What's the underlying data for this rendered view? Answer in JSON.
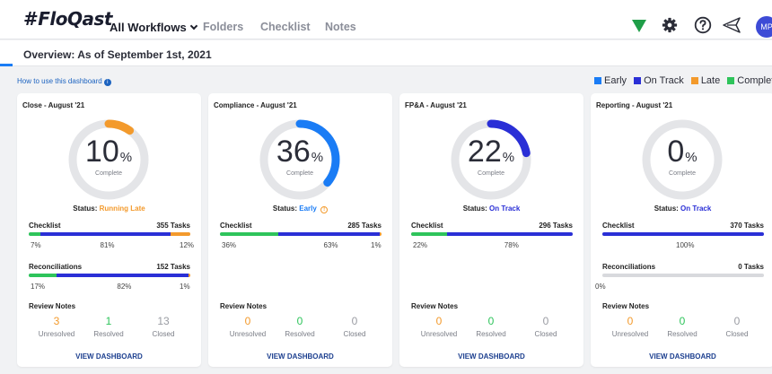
{
  "app": {
    "logo_text": "FloQast",
    "logo_hash": "#",
    "nav_main": "All Workflows",
    "nav": [
      "Folders",
      "Checklist",
      "Notes"
    ],
    "avatar": "MP",
    "icons": [
      "flag-icon",
      "gear-icon",
      "help-icon",
      "send-icon"
    ]
  },
  "overview": "Overview: As of September 1st, 2021",
  "howto": "How to use this dashboard",
  "legend": [
    {
      "label": "Early",
      "color": "#1a7cf5"
    },
    {
      "label": "On Track",
      "color": "#2a2fd6"
    },
    {
      "label": "Late",
      "color": "#f39a2c"
    },
    {
      "label": "Complete",
      "color": "#2ec45b"
    }
  ],
  "colors": {
    "early": "#1a7cf5",
    "on_track": "#2a2fd6",
    "late": "#f39a2c",
    "complete": "#2ec45b",
    "ring": "#e4e5e8",
    "link": "#1c3f8f"
  },
  "cards": [
    {
      "title": "Close - August '21",
      "percent": "10",
      "percent_value": 10,
      "ring_color": "#f39a2c",
      "complete_label": "Complete",
      "status_label": "Status:",
      "status_value": "Running Late",
      "status_color": "#f39a2c",
      "status_warn": "",
      "checklist": {
        "label": "Checklist",
        "tasks": "355 Tasks",
        "segments": [
          {
            "pct": 7,
            "color": "#2ec45b",
            "label": "7%"
          },
          {
            "pct": 81,
            "color": "#2a2fd6",
            "label": "81%"
          },
          {
            "pct": 12,
            "color": "#f39a2c",
            "label": "12%"
          }
        ]
      },
      "reconciliations": {
        "label": "Reconciliations",
        "tasks": "152 Tasks",
        "segments": [
          {
            "pct": 17,
            "color": "#2ec45b",
            "label": "17%"
          },
          {
            "pct": 82,
            "color": "#2a2fd6",
            "label": "82%"
          },
          {
            "pct": 1,
            "color": "#f39a2c",
            "label": "1%"
          }
        ]
      },
      "review_notes": {
        "label": "Review Notes",
        "items": [
          {
            "value": "3",
            "label": "Unresolved",
            "color": "#f39a2c"
          },
          {
            "value": "1",
            "label": "Resolved",
            "color": "#2ec45b"
          },
          {
            "value": "13",
            "label": "Closed",
            "color": "#9a9ca3"
          }
        ]
      },
      "view": "VIEW DASHBOARD"
    },
    {
      "title": "Compliance - August '21",
      "percent": "36",
      "percent_value": 36,
      "ring_color": "#1a7cf5",
      "complete_label": "Complete",
      "status_label": "Status:",
      "status_value": "Early",
      "status_color": "#1a7cf5",
      "status_warn": "!",
      "checklist": {
        "label": "Checklist",
        "tasks": "285 Tasks",
        "segments": [
          {
            "pct": 36,
            "color": "#2ec45b",
            "label": "36%"
          },
          {
            "pct": 63,
            "color": "#2a2fd6",
            "label": "63%"
          },
          {
            "pct": 1,
            "color": "#f39a2c",
            "label": "1%"
          }
        ]
      },
      "reconciliations": null,
      "review_notes": {
        "label": "Review Notes",
        "items": [
          {
            "value": "0",
            "label": "Unresolved",
            "color": "#f39a2c"
          },
          {
            "value": "0",
            "label": "Resolved",
            "color": "#2ec45b"
          },
          {
            "value": "0",
            "label": "Closed",
            "color": "#9a9ca3"
          }
        ]
      },
      "view": "VIEW DASHBOARD"
    },
    {
      "title": "FP&A - August '21",
      "percent": "22",
      "percent_value": 22,
      "ring_color": "#2a2fd6",
      "complete_label": "Complete",
      "status_label": "Status:",
      "status_value": "On Track",
      "status_color": "#2a2fd6",
      "status_warn": "",
      "checklist": {
        "label": "Checklist",
        "tasks": "296 Tasks",
        "segments": [
          {
            "pct": 22,
            "color": "#2ec45b",
            "label": "22%"
          },
          {
            "pct": 78,
            "color": "#2a2fd6",
            "label": "78%"
          }
        ]
      },
      "reconciliations": null,
      "review_notes": {
        "label": "Review Notes",
        "items": [
          {
            "value": "0",
            "label": "Unresolved",
            "color": "#f39a2c"
          },
          {
            "value": "0",
            "label": "Resolved",
            "color": "#2ec45b"
          },
          {
            "value": "0",
            "label": "Closed",
            "color": "#9a9ca3"
          }
        ]
      },
      "view": "VIEW DASHBOARD"
    },
    {
      "title": "Reporting - August '21",
      "percent": "0",
      "percent_value": 0,
      "ring_color": "#2a2fd6",
      "complete_label": "Complete",
      "status_label": "Status:",
      "status_value": "On Track",
      "status_color": "#2a2fd6",
      "status_warn": "",
      "checklist": {
        "label": "Checklist",
        "tasks": "370 Tasks",
        "segments": [
          {
            "pct": 100,
            "color": "#2a2fd6",
            "label": "100%"
          }
        ]
      },
      "reconciliations": {
        "label": "Reconciliations",
        "tasks": "0 Tasks",
        "segments": [
          {
            "pct": 0,
            "color": "#2ec45b",
            "label": "0%"
          }
        ]
      },
      "review_notes": {
        "label": "Review Notes",
        "items": [
          {
            "value": "0",
            "label": "Unresolved",
            "color": "#f39a2c"
          },
          {
            "value": "0",
            "label": "Resolved",
            "color": "#2ec45b"
          },
          {
            "value": "0",
            "label": "Closed",
            "color": "#9a9ca3"
          }
        ]
      },
      "view": "VIEW DASHBOARD"
    }
  ]
}
